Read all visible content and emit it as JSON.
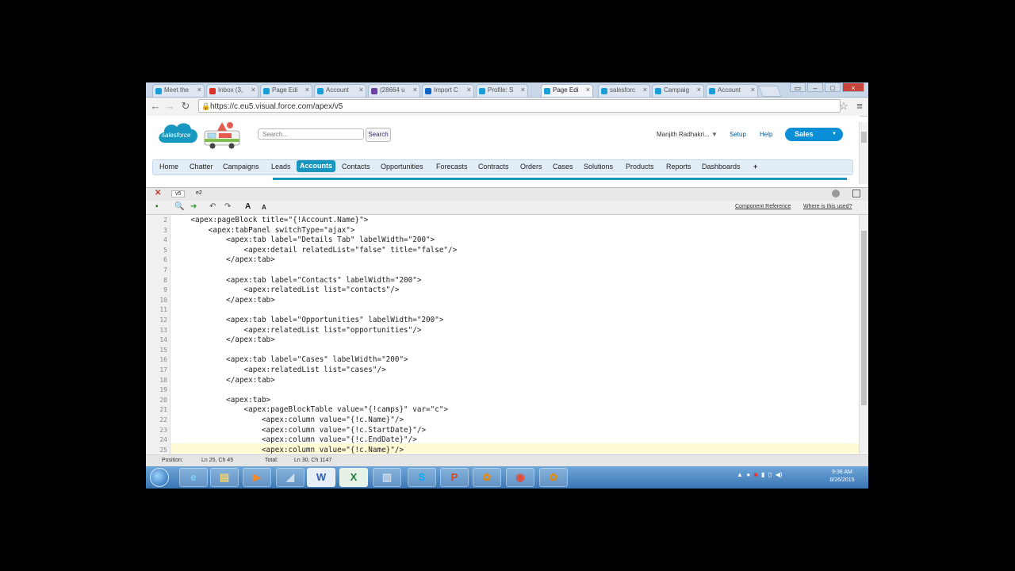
{
  "browser": {
    "tabs": [
      "Meet the",
      "Inbox (3,",
      "Page Edi",
      "Account",
      "(28664 u",
      "Import C",
      "Profile: S",
      "Page Edi",
      "salesforc",
      "Campaig",
      "Account"
    ],
    "url": "https://c.eu5.visual.force.com/apex/v5"
  },
  "header": {
    "search_placeholder": "Search...",
    "search_button": "Search",
    "user_menu": "Manjith Radhakri...",
    "setup": "Setup",
    "help": "Help",
    "app_switcher": "Sales"
  },
  "nav": {
    "items": [
      "Home",
      "Chatter",
      "Campaigns",
      "Leads",
      "Accounts",
      "Contacts",
      "Opportunities",
      "Forecasts",
      "Contracts",
      "Orders",
      "Cases",
      "Solutions",
      "Products",
      "Reports",
      "Dashboards",
      "+"
    ]
  },
  "devfooter": {
    "tab1": "v5",
    "tab2": "e2",
    "component_reference": "Component Reference",
    "where_used": "Where is this used?"
  },
  "editor": {
    "lines": [
      {
        "n": "2",
        "text": "    <apex:pageBlock title=\"{!Account.Name}\">"
      },
      {
        "n": "3",
        "text": "        <apex:tabPanel switchType=\"ajax\">"
      },
      {
        "n": "4",
        "text": "            <apex:tab label=\"Details Tab\" labelWidth=\"200\">"
      },
      {
        "n": "5",
        "text": "                <apex:detail relatedList=\"false\" title=\"false\"/>"
      },
      {
        "n": "6",
        "text": "            </apex:tab>"
      },
      {
        "n": "7",
        "text": ""
      },
      {
        "n": "8",
        "text": "            <apex:tab label=\"Contacts\" labelWidth=\"200\">"
      },
      {
        "n": "9",
        "text": "                <apex:relatedList list=\"contacts\"/>"
      },
      {
        "n": "10",
        "text": "            </apex:tab>"
      },
      {
        "n": "11",
        "text": ""
      },
      {
        "n": "12",
        "text": "            <apex:tab label=\"Opportunities\" labelWidth=\"200\">"
      },
      {
        "n": "13",
        "text": "                <apex:relatedList list=\"opportunities\"/>"
      },
      {
        "n": "14",
        "text": "            </apex:tab>"
      },
      {
        "n": "15",
        "text": ""
      },
      {
        "n": "16",
        "text": "            <apex:tab label=\"Cases\" labelWidth=\"200\">"
      },
      {
        "n": "17",
        "text": "                <apex:relatedList list=\"cases\"/>"
      },
      {
        "n": "18",
        "text": "            </apex:tab>"
      },
      {
        "n": "19",
        "text": ""
      },
      {
        "n": "20",
        "text": "            <apex:tab>"
      },
      {
        "n": "21",
        "text": "                <apex:pageBlockTable value=\"{!camps}\" var=\"c\">"
      },
      {
        "n": "22",
        "text": "                    <apex:column value=\"{!c.Name}\"/>"
      },
      {
        "n": "23",
        "text": "                    <apex:column value=\"{!c.StartDate}\"/>"
      },
      {
        "n": "24",
        "text": "                    <apex:column value=\"{!c.EndDate}\"/>"
      },
      {
        "n": "25",
        "text": "                    <apex:column value=\"{!c.Name}\"/>"
      }
    ]
  },
  "status": {
    "position_label": "Position:",
    "position_value": "Ln 25, Ch 45",
    "total_label": "Total:",
    "total_value": "Ln 30, Ch 1147"
  },
  "taskbar": {
    "time": "9:36 AM",
    "date": "8/26/2015"
  }
}
